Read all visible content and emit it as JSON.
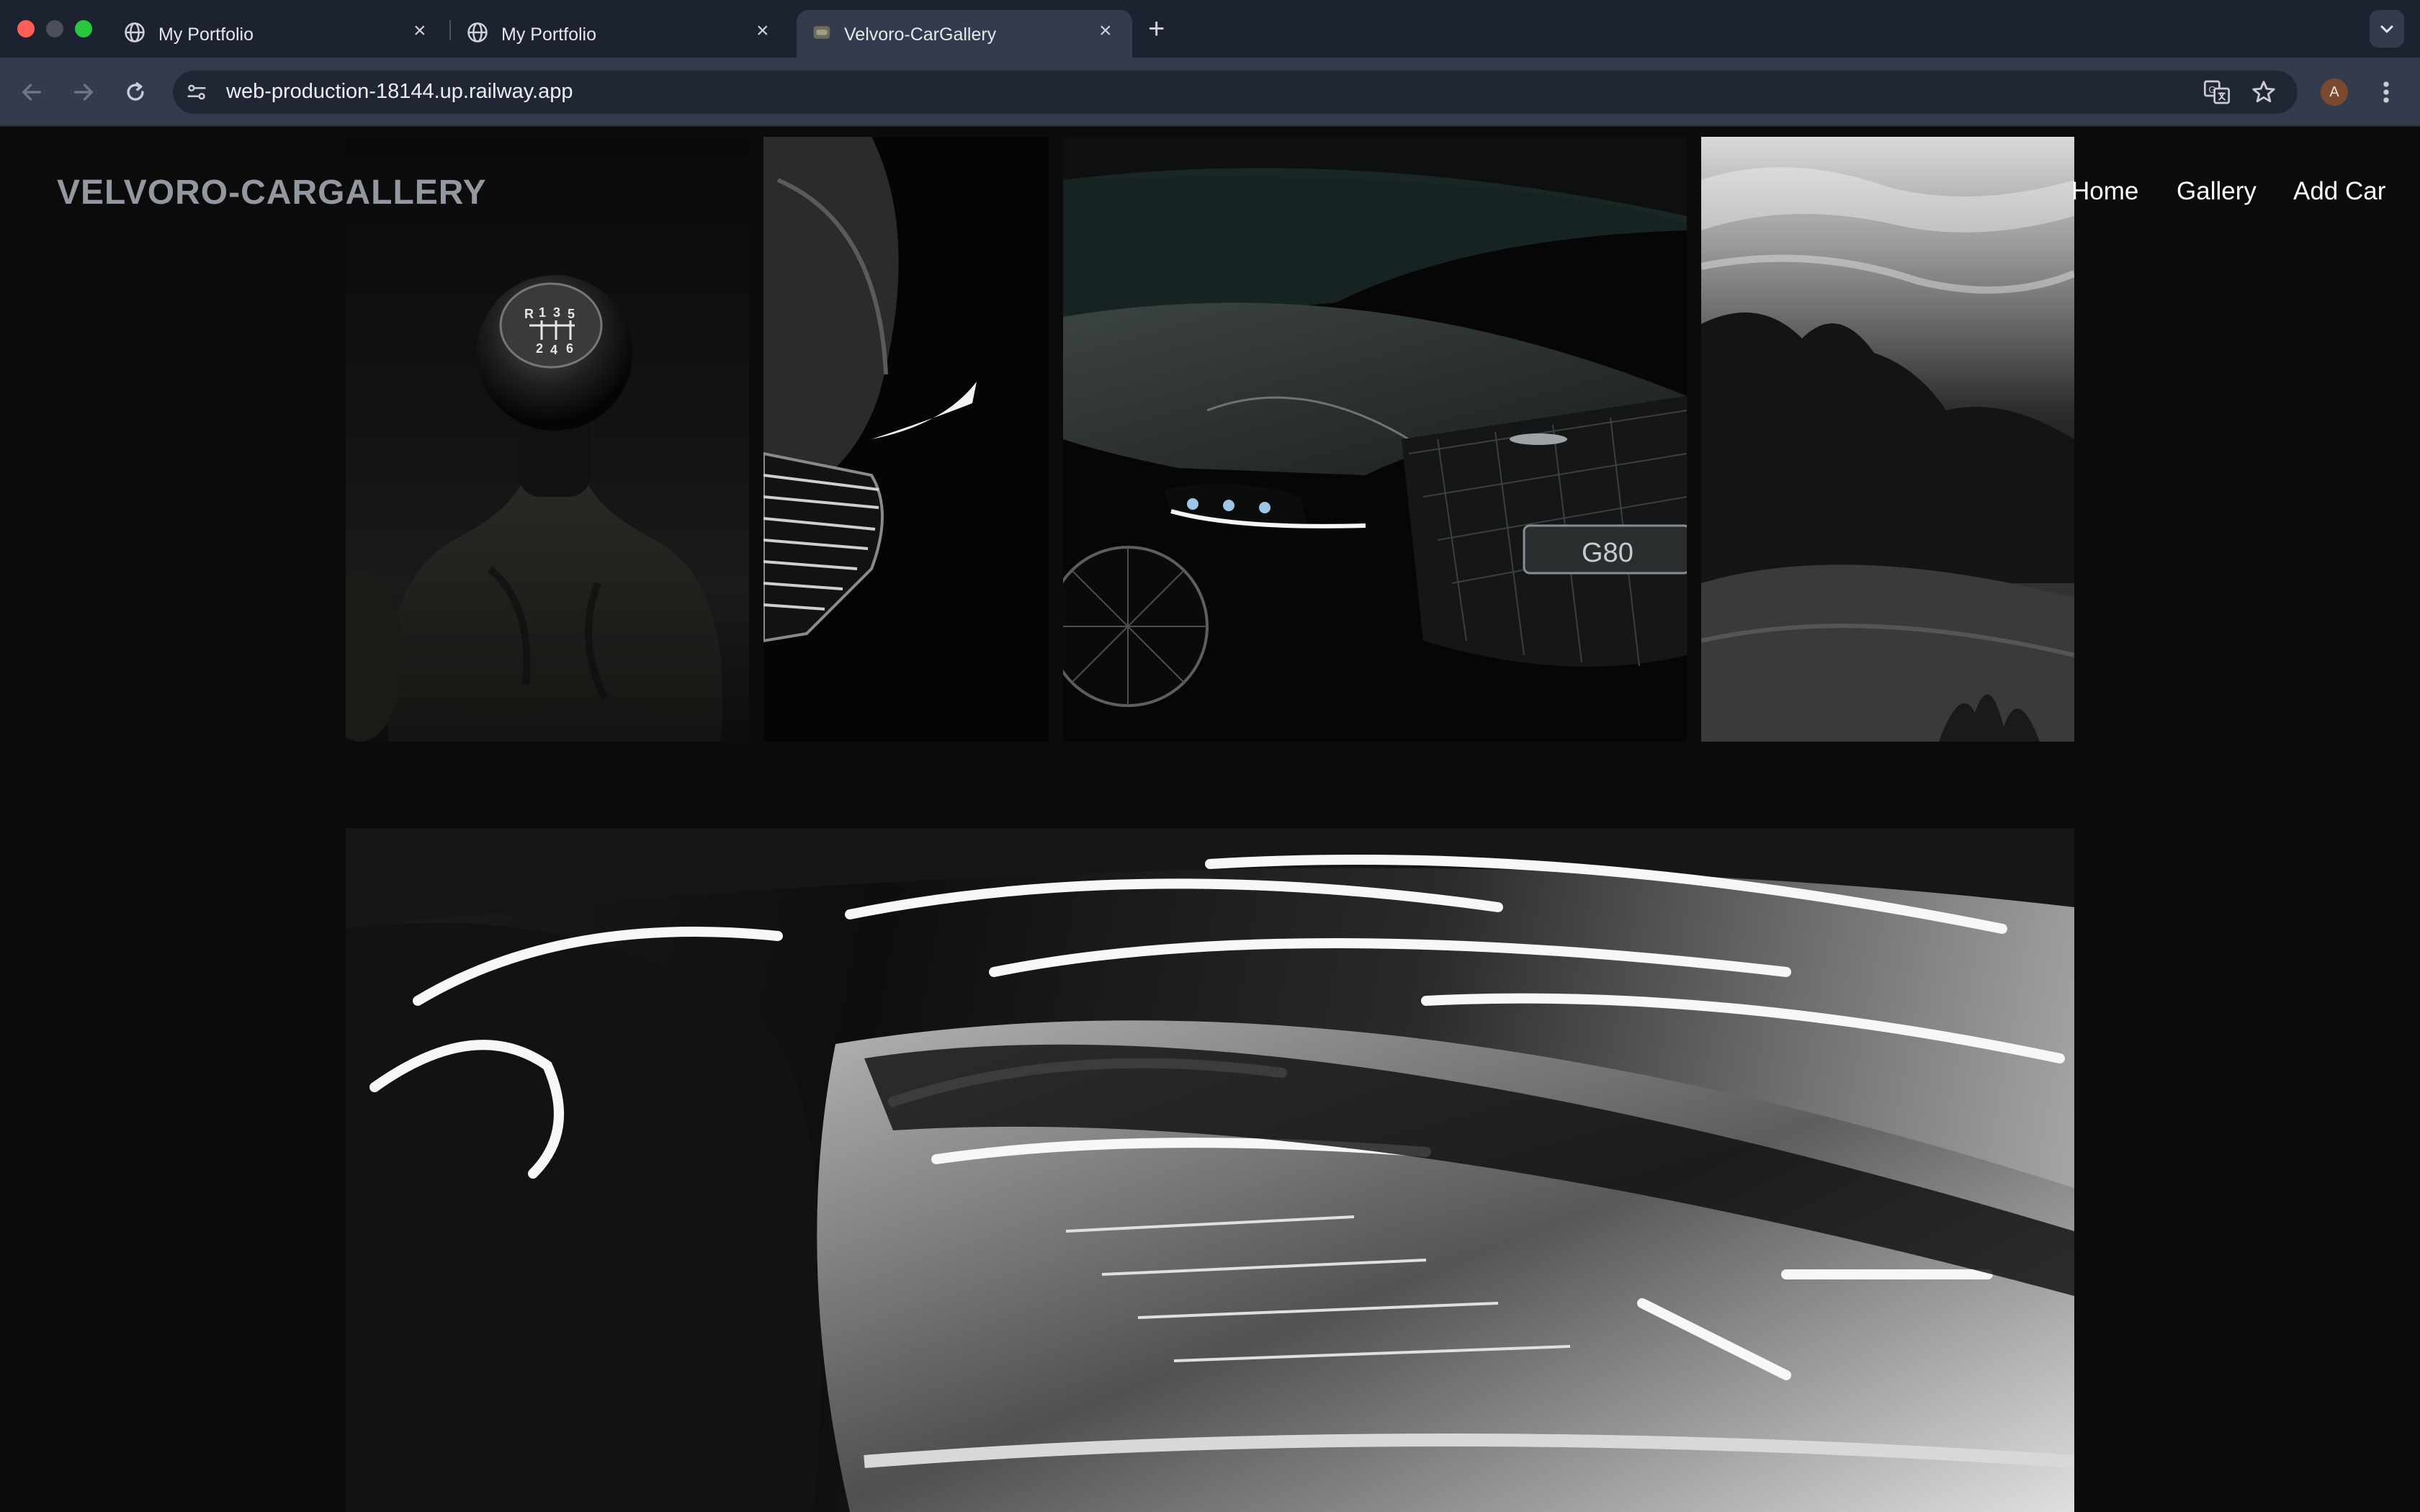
{
  "browser": {
    "tabs": [
      {
        "title": "My Portfolio",
        "active": false,
        "favicon": "globe-icon"
      },
      {
        "title": "My Portfolio",
        "active": false,
        "favicon": "globe-icon"
      },
      {
        "title": "Velvoro-CarGallery",
        "active": true,
        "favicon": "site-favicon"
      }
    ],
    "url": "web-production-18144.up.railway.app",
    "profile_initial": "A",
    "colors": {
      "tabbar": "#1d2230",
      "toolbar": "#343b4c",
      "omnibox": "#202634"
    }
  },
  "site": {
    "brand": "VELVORO-CARGALLERY",
    "nav": {
      "home": "Home",
      "gallery": "Gallery",
      "add_car": "Add Car"
    },
    "gallery_images": [
      {
        "subject": "manual gear shift knob"
      },
      {
        "subject": "car front grille close-up"
      },
      {
        "subject": "black Genesis G80 front"
      },
      {
        "subject": "landscape with trees and sky"
      },
      {
        "subject": "wrapped car headlight close-up",
        "plate_text": "G80"
      }
    ],
    "colors": {
      "background": "#0b0b0b",
      "brand": "#93979f",
      "nav_text": "#ffffff"
    }
  }
}
